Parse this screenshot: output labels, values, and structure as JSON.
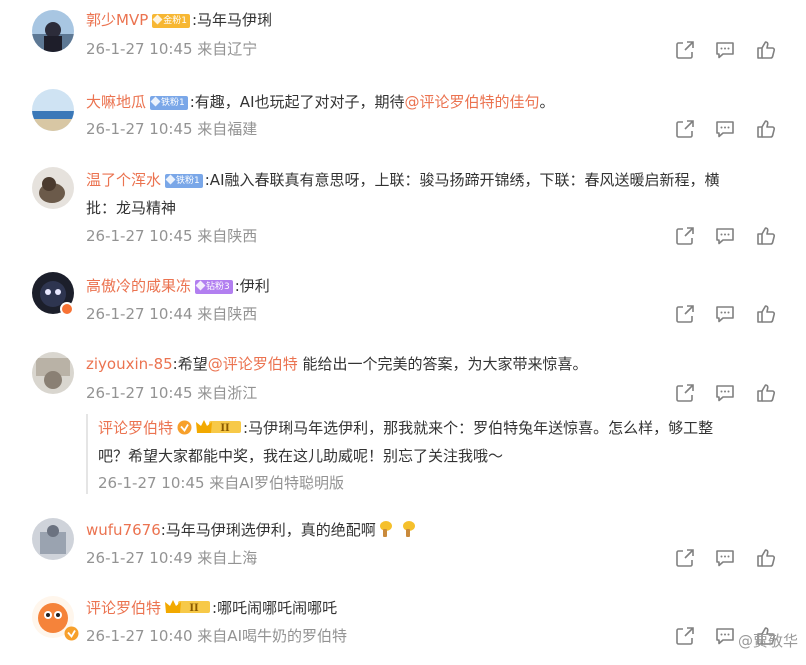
{
  "comments": [
    {
      "user": "郭少MVP",
      "badge": "金粉1",
      "text": ":马年马伊琍",
      "meta": "26-1-27 10:45 来自辽宁"
    },
    {
      "user": "大嘛地瓜",
      "badge": "铁粉1",
      "text_before": ":有趣，AI也玩起了对对子，期待",
      "mention": "@评论罗伯特的佳句",
      "text_after": "。",
      "meta": "26-1-27 10:45 来自福建"
    },
    {
      "user": "温了个浑水",
      "badge": "铁粉1",
      "text_line1": ":AI融入春联真有意思呀，上联：骏马扬蹄开锦绣，下联：春风送暖启新程，横",
      "text_line2": "批：龙马精神",
      "meta": "26-1-27 10:45 来自陕西"
    },
    {
      "user": "高傲冷的咸果冻",
      "badge": "钻粉3",
      "text": ":伊利",
      "meta": "26-1-27 10:44 来自陕西"
    },
    {
      "user": "ziyouxin-85",
      "text_before": ":希望",
      "mention": "@评论罗伯特",
      "text_after": " 能给出一个完美的答案，为大家带来惊喜。",
      "meta": "26-1-27 10:45 来自浙江",
      "reply": {
        "user": "评论罗伯特",
        "level": "II",
        "text_line1": ":马伊琍马年选伊利，那我就来个：罗伯特兔年送惊喜。怎么样，够工整",
        "text_line2": "吧？希望大家都能中奖，我在这儿助威呢！别忘了关注我哦～",
        "meta": "26-1-27 10:45 来自AI罗伯特聪明版"
      }
    },
    {
      "user": "wufu7676",
      "text": ":马年马伊琍选伊利，真的绝配啊",
      "emoji": [
        "thumbs-up-emoji",
        "thumbs-up-emoji"
      ],
      "meta": "26-1-27 10:49 来自上海"
    },
    {
      "user": "评论罗伯特",
      "level": "II",
      "text": ":哪吒闹哪吒闹哪吒",
      "meta": "26-1-27 10:40 来自AI喝牛奶的罗伯特"
    }
  ],
  "watermark": "@贾敬华",
  "colors": {
    "username": "#eb7350",
    "meta": "#939393",
    "text": "#333333",
    "badge_gold": "#f7b733",
    "badge_iron": "#7aa7e8",
    "badge_diamond": "#b27ff0"
  },
  "icons": [
    "share-icon",
    "comment-icon",
    "like-icon"
  ]
}
